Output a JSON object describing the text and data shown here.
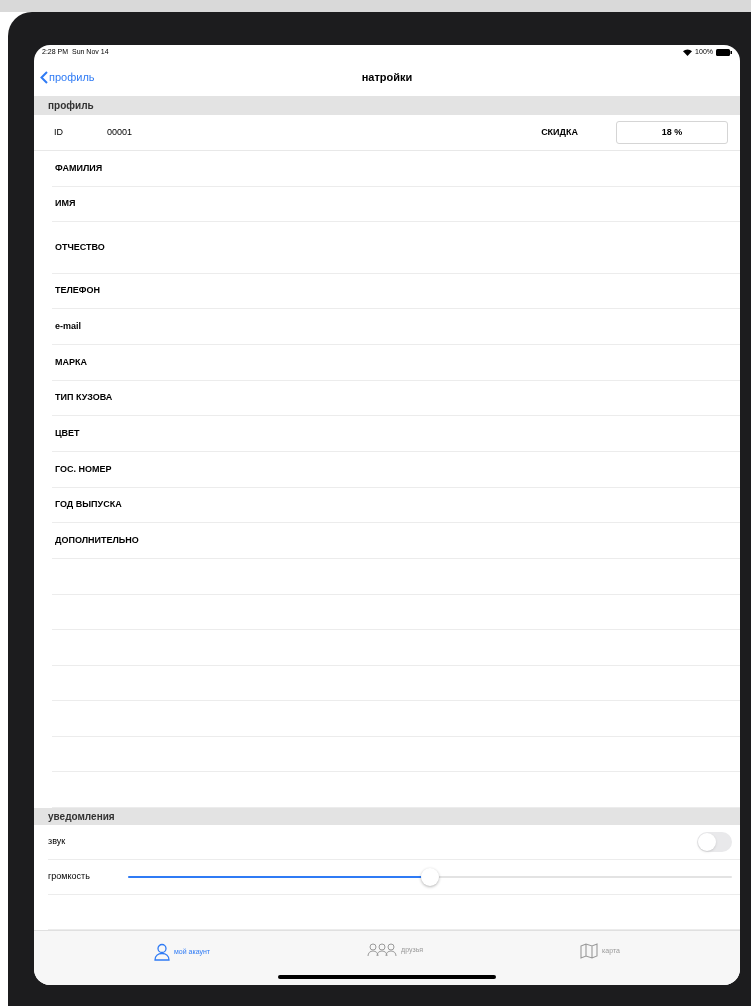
{
  "status_bar": {
    "time": "2:28 PM",
    "date": "Sun Nov 14",
    "battery": "100%"
  },
  "nav": {
    "back": "профиль",
    "title": "натройки"
  },
  "profile": {
    "header": "профиль",
    "id_label": "ID",
    "id_value": "00001",
    "discount_label": "СКИДКА",
    "discount_value": "18 %",
    "fields": [
      {
        "label": "ФАМИЛИЯ",
        "kind": "normal"
      },
      {
        "label": "ИМЯ",
        "kind": "normal"
      },
      {
        "label": "ОТЧЕСТВО",
        "kind": "tall"
      },
      {
        "label": "ТЕЛЕФОН",
        "kind": "normal"
      },
      {
        "label": "e-mail",
        "kind": "normal"
      },
      {
        "label": "МАРКА",
        "kind": "normal"
      },
      {
        "label": "ТИП КУЗОВА",
        "kind": "normal"
      },
      {
        "label": "ЦВЕТ",
        "kind": "normal"
      },
      {
        "label": "ГОС. НОМЕР",
        "kind": "normal"
      },
      {
        "label": "ГОД ВЫПУСКА",
        "kind": "normal"
      },
      {
        "label": "ДОПОЛНИТЕЛЬНО",
        "kind": "normal"
      }
    ]
  },
  "notifications": {
    "header": "уведомления",
    "sound": {
      "label": "звук",
      "on": false
    },
    "volume": {
      "label": "громкость",
      "level": 0.5
    }
  },
  "tabs": [
    {
      "label": "мой акаунт",
      "kind": "person",
      "selected": true
    },
    {
      "label": "друзья",
      "kind": "people",
      "selected": false
    },
    {
      "label": "карта",
      "kind": "map",
      "selected": false
    }
  ]
}
